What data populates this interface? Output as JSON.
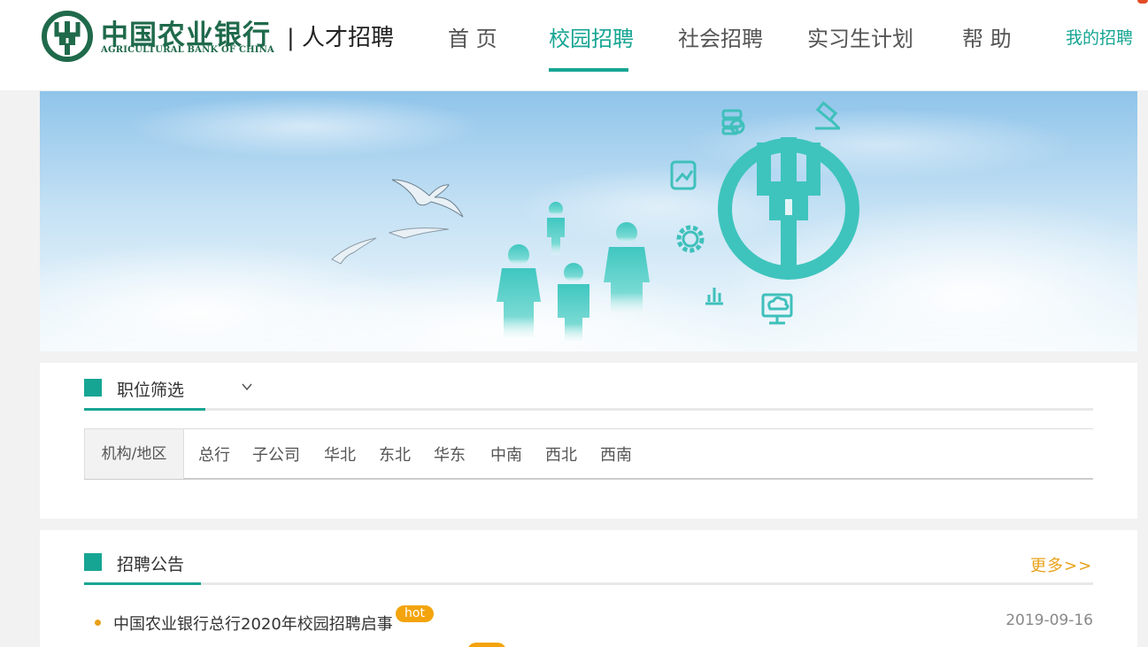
{
  "header": {
    "bank_name_cn": "中国农业银行",
    "bank_name_en": "AGRICULTURAL BANK OF CHINA",
    "portal_name": "| 人才招聘",
    "brand_color": "#17a593",
    "logo_color": "#1f6a4b",
    "nav": [
      {
        "label": "首 页",
        "active": false
      },
      {
        "label": "校园招聘",
        "active": true
      },
      {
        "label": "社会招聘",
        "active": false
      },
      {
        "label": "实习生计划",
        "active": false
      },
      {
        "label": "帮 助",
        "active": false
      }
    ],
    "my_recruit": "我的招聘"
  },
  "banner": {
    "icons": [
      "coins-icon",
      "gavel-icon",
      "chart-doc-icon",
      "gear-icon",
      "bar-chart-icon",
      "cloud-monitor-icon",
      "abc-logo-icon",
      "people-icon",
      "seagull-icon"
    ]
  },
  "filter": {
    "title": "职位筛选",
    "label": "机构/地区",
    "options": [
      "总行",
      "子公司",
      "华北",
      "东北",
      "华东",
      "中南",
      "西北",
      "西南"
    ]
  },
  "notices": {
    "title": "招聘公告",
    "more": "更多>>",
    "items": [
      {
        "title": "中国农业银行总行2020年校园招聘启事",
        "badge": "hot",
        "date": "2019-09-16"
      }
    ]
  }
}
